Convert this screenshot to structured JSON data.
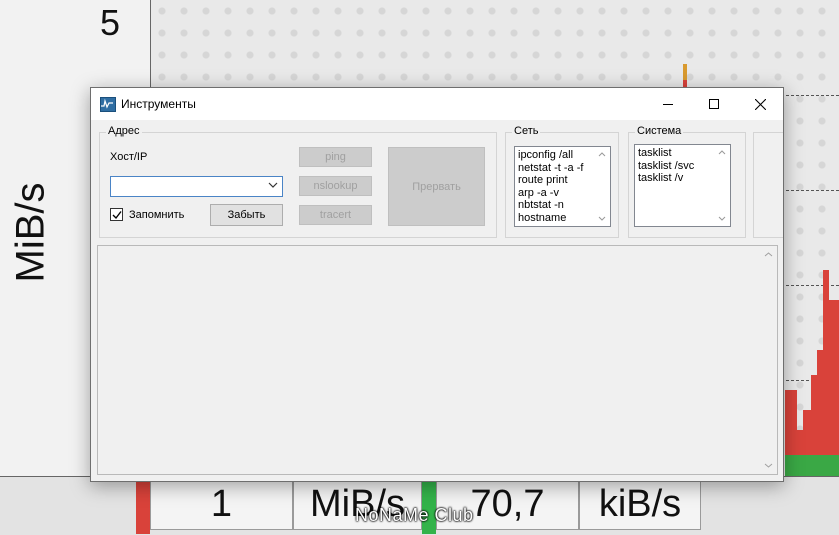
{
  "background": {
    "top_value": "5",
    "y_axis_label": "MiB/s",
    "bottom_cells": [
      "1",
      "MiB/s",
      "70,7",
      "kiB/s"
    ],
    "watermark": "NoNaMe Club",
    "colors": {
      "upload": "#d9423a",
      "download": "#33b34a"
    }
  },
  "dialog": {
    "title": "Инструменты",
    "icon": "network-monitor-icon",
    "window_buttons": [
      "minimize-icon",
      "maximize-icon",
      "close-icon"
    ],
    "address_group": {
      "label": "Адрес",
      "host_label": "Хост/IP",
      "host_value": "",
      "remember_label": "Запомнить",
      "remember_checked": true,
      "forget_button": "Забыть",
      "ping_button": "ping",
      "nslookup_button": "nslookup",
      "tracert_button": "tracert",
      "abort_button": "Прервать"
    },
    "network_group": {
      "label": "Сеть",
      "items": [
        "ipconfig /all",
        "netstat -t -a -f",
        "route print",
        "arp -a -v",
        "nbtstat -n",
        "hostname"
      ]
    },
    "system_group": {
      "label": "Система",
      "items": [
        "tasklist",
        "tasklist /svc",
        "tasklist /v"
      ]
    },
    "output_text": ""
  }
}
